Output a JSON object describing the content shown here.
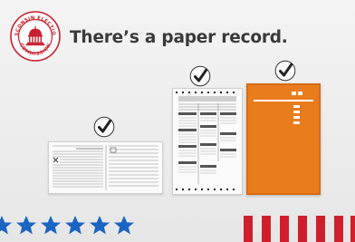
{
  "seal": {
    "top_text": "WISCONSIN ELECTIONS",
    "bottom_text": "COMMISSION",
    "icon": "capitol-dome-icon",
    "color": "#c8202f"
  },
  "headline": "There’s a paper record.",
  "colors": {
    "star_blue": "#1a65c2",
    "stripe_red": "#d01f2c",
    "ballot_orange": "#e97c1d",
    "text_gray": "#3a3a3a"
  },
  "ballots": [
    {
      "name": "absentee-certificate-envelope",
      "checked": true
    },
    {
      "name": "paper-ballot",
      "checked": true
    },
    {
      "name": "orange-ballot",
      "checked": true
    }
  ],
  "decor": {
    "star_icon": "star-icon",
    "stripe_icon": "stripe"
  }
}
